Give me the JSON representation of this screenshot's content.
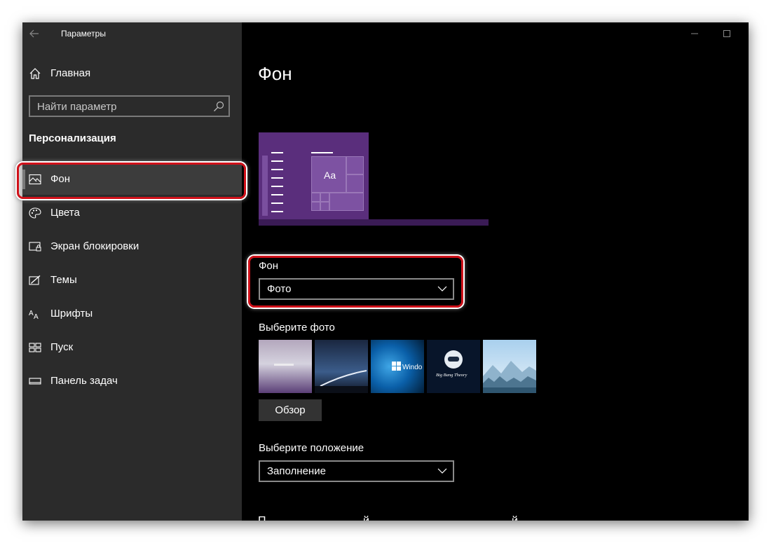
{
  "titlebar": {
    "title": "Параметры",
    "back_icon": "back-arrow-icon",
    "controls": [
      "minimize-icon",
      "maximize-icon",
      "close-icon"
    ]
  },
  "sidebar": {
    "home": {
      "label": "Главная",
      "icon": "home-icon"
    },
    "search": {
      "placeholder": "Найти параметр",
      "icon": "search-icon"
    },
    "section": "Персонализация",
    "items": [
      {
        "label": "Фон",
        "icon": "picture-icon",
        "active": true
      },
      {
        "label": "Цвета",
        "icon": "palette-icon"
      },
      {
        "label": "Экран блокировки",
        "icon": "lock-screen-icon"
      },
      {
        "label": "Темы",
        "icon": "themes-icon"
      },
      {
        "label": "Шрифты",
        "icon": "fonts-icon"
      },
      {
        "label": "Пуск",
        "icon": "start-icon"
      },
      {
        "label": "Панель задач",
        "icon": "taskbar-icon"
      }
    ]
  },
  "main": {
    "title": "Фон",
    "preview": {
      "sample_text": "Aa"
    },
    "background": {
      "label": "Фон",
      "value": "Фото"
    },
    "choose_photo": {
      "label": "Выберите фото",
      "thumbnails": [
        {
          "text": ""
        },
        {
          "text": ""
        },
        {
          "text": "Windo"
        },
        {
          "text": "Big Bang Theory"
        },
        {
          "text": ""
        }
      ]
    },
    "browse_button": "Обзор",
    "position": {
      "label": "Выберите положение",
      "value": "Заполнение"
    }
  },
  "colors": {
    "sidebar_bg": "#2b2b2b",
    "main_bg": "#000000",
    "accent_purple": "#5a2e7c",
    "highlight_red": "#d0111a"
  }
}
